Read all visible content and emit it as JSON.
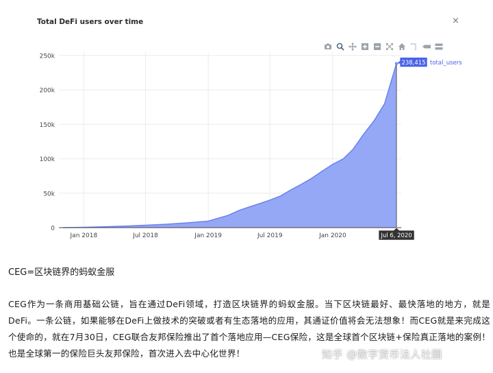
{
  "panel": {
    "title": "Total DeFi users over time",
    "close_label": "×"
  },
  "modebar": {
    "icons": [
      "camera-icon",
      "zoom-icon",
      "pan-icon",
      "zoom-in-icon",
      "zoom-out-icon",
      "autoscale-icon",
      "reset-axes-icon",
      "spike-lines-icon",
      "hover-closest-icon",
      "hover-compare-icon"
    ]
  },
  "chart_data": {
    "type": "area",
    "series": [
      {
        "name": "total_users",
        "color": "#95a8f5",
        "line_color": "#6a80f0",
        "x": [
          "2017-11-01",
          "2018-01-01",
          "2018-03-01",
          "2018-05-01",
          "2018-07-01",
          "2018-09-01",
          "2018-11-01",
          "2019-01-01",
          "2019-03-01",
          "2019-04-01",
          "2019-05-01",
          "2019-06-01",
          "2019-07-01",
          "2019-08-01",
          "2019-09-01",
          "2019-10-01",
          "2019-11-01",
          "2019-12-01",
          "2020-01-01",
          "2020-02-01",
          "2020-03-01",
          "2020-04-01",
          "2020-05-01",
          "2020-06-01",
          "2020-07-06"
        ],
        "values": [
          0,
          500,
          1200,
          2200,
          3500,
          5000,
          7000,
          9500,
          18000,
          25000,
          30000,
          35000,
          40000,
          46000,
          55000,
          63000,
          72000,
          82000,
          92000,
          100000,
          114000,
          136000,
          155000,
          180000,
          238415
        ]
      }
    ],
    "hover": {
      "value_label": "238,415",
      "x_label": "Jul 6, 2020",
      "series_label": "total_users"
    },
    "x_ticks": [
      {
        "date": "2018-01-01",
        "label": "Jan 2018"
      },
      {
        "date": "2018-07-01",
        "label": "Jul 2018"
      },
      {
        "date": "2019-01-01",
        "label": "Jan 2019"
      },
      {
        "date": "2019-07-01",
        "label": "Jul 2019"
      },
      {
        "date": "2020-01-01",
        "label": "Jan 2020"
      }
    ],
    "y_ticks": [
      {
        "value": 0,
        "label": "0"
      },
      {
        "value": 50000,
        "label": "50k"
      },
      {
        "value": 100000,
        "label": "100k"
      },
      {
        "value": 150000,
        "label": "150k"
      },
      {
        "value": 200000,
        "label": "200k"
      },
      {
        "value": 250000,
        "label": "250k"
      }
    ],
    "xlim": [
      "2017-10-20",
      "2020-07-20"
    ],
    "ylim": [
      0,
      255000
    ],
    "grid": true,
    "legend": "none"
  },
  "article": {
    "caption": "CEG=区块链界的蚂蚁金服",
    "paragraph": "CEG作为一条商用基础公链，旨在通过DeFi领域，打造区块链界的蚂蚁金服。当下区块链最好、最快落地的地方，就是DeFi。一条公链，如果能够在DeFi上做技术的突破或者有生态落地的应用，其通证价值将会无法想象！而CEG就是来完成这个使命的，就在7月30日，CEG联合友邦保险推出了首个落地应用—CEG保险，这是全球首个区块链+保险真正落地的案例！也是全球第一的保险巨头友邦保险，首次进入去中心化世界！",
    "watermark": "知乎 @数字货币法人社圈"
  }
}
